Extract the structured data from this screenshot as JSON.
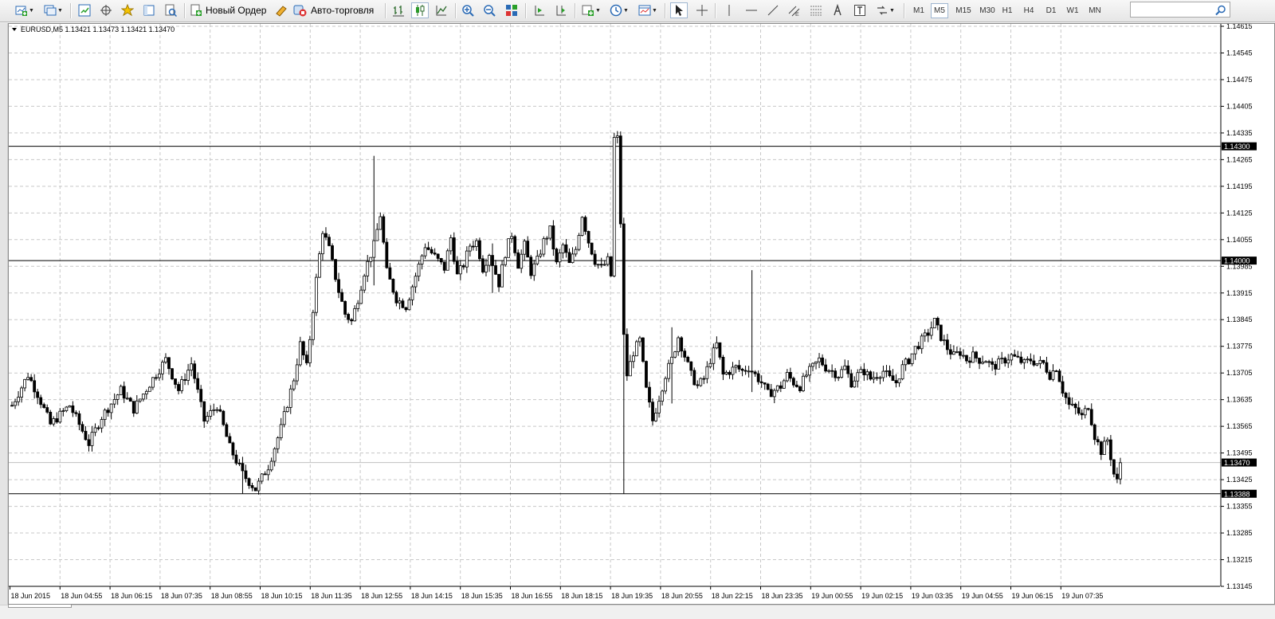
{
  "toolbar": {
    "new_order_label": "Новый Ордер",
    "autotrading_label": "Авто-торговля",
    "icons": [
      "new-chart-icon",
      "profiles-icon",
      "market-watch-icon",
      "navigator-icon",
      "favorites-icon",
      "data-window-icon",
      "strategy-tester-icon",
      "new-order-icon",
      "metaeditor-icon",
      "autotrading-icon",
      "bar-chart-icon",
      "candlestick-icon",
      "line-chart-icon",
      "zoom-in-icon",
      "zoom-out-icon",
      "tile-windows-icon",
      "chart-shift-icon",
      "autoscroll-icon",
      "indicators-icon",
      "periods-icon",
      "templates-icon",
      "cursor-icon",
      "crosshair-icon",
      "vertical-line-icon",
      "horizontal-line-icon",
      "trendline-icon",
      "equidistant-channel-icon",
      "fibonacci-icon",
      "text-icon",
      "text-label-icon",
      "arrows-icon"
    ]
  },
  "timeframes": {
    "items": [
      "M1",
      "M5",
      "M15",
      "M30",
      "H1",
      "H4",
      "D1",
      "W1",
      "MN"
    ],
    "active": "M5"
  },
  "search": {
    "placeholder": ""
  },
  "chart": {
    "header": "EURUSD,M5  1.13421 1.13473 1.13421 1.13470",
    "price_ticks": [
      {
        "v": 1.14615,
        "t": "1.14615"
      },
      {
        "v": 1.14545,
        "t": "1.14545"
      },
      {
        "v": 1.14475,
        "t": "1.14475"
      },
      {
        "v": 1.14405,
        "t": "1.14405"
      },
      {
        "v": 1.14335,
        "t": "1.14335"
      },
      {
        "v": 1.14265,
        "t": "1.14265"
      },
      {
        "v": 1.14195,
        "t": "1.14195"
      },
      {
        "v": 1.14125,
        "t": "1.14125"
      },
      {
        "v": 1.14055,
        "t": "1.14055"
      },
      {
        "v": 1.13985,
        "t": "1.13985"
      },
      {
        "v": 1.13915,
        "t": "1.13915"
      },
      {
        "v": 1.13845,
        "t": "1.13845"
      },
      {
        "v": 1.13775,
        "t": "1.13775"
      },
      {
        "v": 1.13705,
        "t": "1.13705"
      },
      {
        "v": 1.13635,
        "t": "1.13635"
      },
      {
        "v": 1.13565,
        "t": "1.13565"
      },
      {
        "v": 1.13495,
        "t": "1.13495"
      },
      {
        "v": 1.13425,
        "t": "1.13425"
      },
      {
        "v": 1.13355,
        "t": "1.13355"
      },
      {
        "v": 1.13285,
        "t": "1.13285"
      },
      {
        "v": 1.13215,
        "t": "1.13215"
      },
      {
        "v": 1.13145,
        "t": "1.13145"
      }
    ],
    "time_labels": [
      "18 Jun 2015",
      "18 Jun 04:55",
      "18 Jun 06:15",
      "18 Jun 07:35",
      "18 Jun 08:55",
      "18 Jun 10:15",
      "18 Jun 11:35",
      "18 Jun 12:55",
      "18 Jun 14:15",
      "18 Jun 15:35",
      "18 Jun 16:55",
      "18 Jun 18:15",
      "18 Jun 19:35",
      "18 Jun 20:55",
      "18 Jun 22:15",
      "18 Jun 23:35",
      "19 Jun 00:55",
      "19 Jun 02:15",
      "19 Jun 03:35",
      "19 Jun 04:55",
      "19 Jun 06:15",
      "19 Jun 07:35"
    ],
    "levels": [
      {
        "v": 1.143,
        "t": "1.14300",
        "kind": "hline"
      },
      {
        "v": 1.14,
        "t": "1.14000",
        "kind": "hline"
      },
      {
        "v": 1.1347,
        "t": "1.13470",
        "kind": "bid"
      },
      {
        "v": 1.13388,
        "t": "1.13388",
        "kind": "hline"
      }
    ],
    "price_path": [
      [
        0,
        1.1362
      ],
      [
        5,
        1.137
      ],
      [
        8,
        1.1365
      ],
      [
        12,
        1.1357
      ],
      [
        18,
        1.1362
      ],
      [
        24,
        1.1352
      ],
      [
        28,
        1.1359
      ],
      [
        34,
        1.1366
      ],
      [
        38,
        1.1361
      ],
      [
        44,
        1.1369
      ],
      [
        48,
        1.1374
      ],
      [
        52,
        1.1366
      ],
      [
        56,
        1.1373
      ],
      [
        60,
        1.1358
      ],
      [
        64,
        1.1362
      ],
      [
        68,
        1.1351
      ],
      [
        72,
        1.1344
      ],
      [
        76,
        1.134
      ],
      [
        80,
        1.1346
      ],
      [
        84,
        1.1356
      ],
      [
        88,
        1.1369
      ],
      [
        90,
        1.1378
      ],
      [
        92,
        1.1372
      ],
      [
        95,
        1.1395
      ],
      [
        97,
        1.1408
      ],
      [
        99,
        1.1403
      ],
      [
        102,
        1.1392
      ],
      [
        104,
        1.1386
      ],
      [
        106,
        1.1384
      ],
      [
        108,
        1.139
      ],
      [
        110,
        1.1397
      ],
      [
        113,
        1.1404
      ],
      [
        115,
        1.1412
      ],
      [
        117,
        1.1397
      ],
      [
        120,
        1.139
      ],
      [
        123,
        1.1388
      ],
      [
        126,
        1.1396
      ],
      [
        129,
        1.1404
      ],
      [
        132,
        1.1401
      ],
      [
        135,
        1.1398
      ],
      [
        137,
        1.1406
      ],
      [
        139,
        1.1396
      ],
      [
        141,
        1.1399
      ],
      [
        143,
        1.1404
      ],
      [
        145,
        1.1405
      ],
      [
        147,
        1.1398
      ],
      [
        149,
        1.1402
      ],
      [
        152,
        1.1394
      ],
      [
        154,
        1.1402
      ],
      [
        156,
        1.1407
      ],
      [
        158,
        1.1399
      ],
      [
        160,
        1.1404
      ],
      [
        162,
        1.1397
      ],
      [
        164,
        1.14
      ],
      [
        166,
        1.1405
      ],
      [
        168,
        1.1408
      ],
      [
        170,
        1.1399
      ],
      [
        172,
        1.1404
      ],
      [
        174,
        1.1399
      ],
      [
        176,
        1.1403
      ],
      [
        178,
        1.1412
      ],
      [
        180,
        1.1405
      ],
      [
        182,
        1.14
      ],
      [
        184,
        1.1398
      ],
      [
        186,
        1.14
      ],
      [
        187,
        1.1396
      ],
      [
        188,
        1.1432
      ],
      [
        189,
        1.1432
      ],
      [
        190,
        1.141
      ],
      [
        191,
        1.138
      ],
      [
        192,
        1.137
      ],
      [
        194,
        1.1376
      ],
      [
        196,
        1.1379
      ],
      [
        198,
        1.1366
      ],
      [
        200,
        1.1358
      ],
      [
        202,
        1.1364
      ],
      [
        204,
        1.137
      ],
      [
        206,
        1.1374
      ],
      [
        208,
        1.138
      ],
      [
        210,
        1.1375
      ],
      [
        212,
        1.137
      ],
      [
        214,
        1.1367
      ],
      [
        216,
        1.1369
      ],
      [
        218,
        1.1374
      ],
      [
        220,
        1.1378
      ],
      [
        222,
        1.137
      ],
      [
        224,
        1.1371
      ],
      [
        226,
        1.1372
      ],
      [
        228,
        1.1371
      ],
      [
        230,
        1.1372
      ],
      [
        232,
        1.137
      ],
      [
        234,
        1.1368
      ],
      [
        236,
        1.1365
      ],
      [
        238,
        1.1366
      ],
      [
        240,
        1.1367
      ],
      [
        242,
        1.137
      ],
      [
        244,
        1.1368
      ],
      [
        246,
        1.1367
      ],
      [
        248,
        1.137
      ],
      [
        250,
        1.1372
      ],
      [
        252,
        1.1374
      ],
      [
        254,
        1.1372
      ],
      [
        256,
        1.1371
      ],
      [
        258,
        1.137
      ],
      [
        260,
        1.1372
      ],
      [
        262,
        1.1368
      ],
      [
        264,
        1.137
      ],
      [
        266,
        1.1371
      ],
      [
        268,
        1.1369
      ],
      [
        270,
        1.137
      ],
      [
        272,
        1.1371
      ],
      [
        274,
        1.1369
      ],
      [
        276,
        1.1368
      ],
      [
        278,
        1.1372
      ],
      [
        280,
        1.1374
      ],
      [
        282,
        1.1377
      ],
      [
        284,
        1.1379
      ],
      [
        286,
        1.1381
      ],
      [
        288,
        1.1384
      ],
      [
        290,
        1.138
      ],
      [
        292,
        1.1377
      ],
      [
        294,
        1.1375
      ],
      [
        296,
        1.1376
      ],
      [
        298,
        1.1374
      ],
      [
        300,
        1.1375
      ],
      [
        302,
        1.1374
      ],
      [
        304,
        1.1374
      ],
      [
        306,
        1.1372
      ],
      [
        308,
        1.1373
      ],
      [
        310,
        1.1374
      ],
      [
        312,
        1.1375
      ],
      [
        314,
        1.1374
      ],
      [
        316,
        1.1373
      ],
      [
        318,
        1.1374
      ],
      [
        320,
        1.1373
      ],
      [
        322,
        1.1373
      ],
      [
        324,
        1.137
      ],
      [
        326,
        1.1372
      ],
      [
        328,
        1.1366
      ],
      [
        330,
        1.1362
      ],
      [
        332,
        1.1361
      ],
      [
        334,
        1.1359
      ],
      [
        336,
        1.1362
      ],
      [
        338,
        1.1354
      ],
      [
        340,
        1.135
      ],
      [
        342,
        1.1353
      ],
      [
        344,
        1.1344
      ],
      [
        345,
        1.1342
      ],
      [
        346,
        1.1347
      ]
    ],
    "spikes": [
      {
        "i": 150,
        "h": 1.14045,
        "l": 1.13915
      },
      {
        "i": 113,
        "h": 1.14275,
        "l": 1.13935
      },
      {
        "i": 191,
        "h": 1.14065,
        "l": 1.13388
      },
      {
        "i": 231,
        "h": 1.13975,
        "l": 1.13655
      },
      {
        "i": 72,
        "h": 1.13485,
        "l": 1.13388
      },
      {
        "i": 206,
        "h": 1.13825,
        "l": 1.13625
      }
    ]
  }
}
